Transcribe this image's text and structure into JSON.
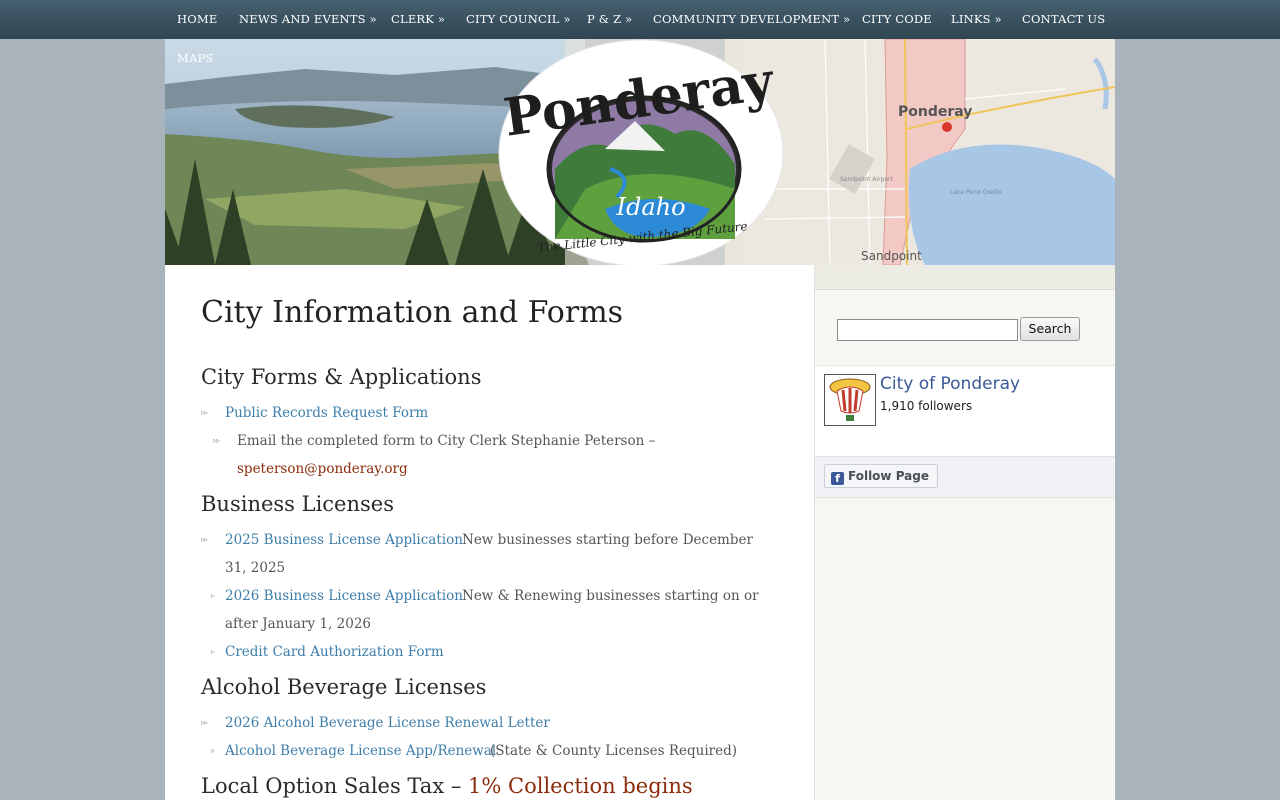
{
  "nav": {
    "items": [
      "HOME",
      "NEWS AND EVENTS »",
      "CLERK »",
      "CITY COUNCIL »",
      "P & Z »",
      "COMMUNITY DEVELOPMENT »",
      "CITY CODE",
      "LINKS »",
      "CONTACT US"
    ],
    "maps": "MAPS"
  },
  "logo": {
    "brand": "Ponderay",
    "state": "Idaho",
    "tagline": "The Little City with the Big Future"
  },
  "map": {
    "city_label": "Ponderay",
    "town_label": "Sandpoint",
    "lake_label": "Lake Pend Oreille",
    "airport_label": "Sandpoint Airport"
  },
  "page": {
    "title": "City Information and Forms"
  },
  "sections": {
    "forms": {
      "heading": "City Forms & Applications",
      "public_records_link": "Public Records Request Form",
      "email_note": "Email the completed form to City Clerk Stephanie Peterson –",
      "email": "speterson@ponderay.org"
    },
    "business": {
      "heading": "Business Licenses",
      "app_2025_link": "2025 Business License Application",
      "app_2025_desc_1": "New businesses starting before December",
      "app_2025_desc_2": "31, 2025",
      "app_2026_link": "2026 Business License Application",
      "app_2026_desc_1": "New & Renewing businesses starting on or",
      "app_2026_desc_2": "after January 1, 2026",
      "credit_card_link": "Credit Card Authorization Form"
    },
    "alcohol": {
      "heading": "Alcohol Beverage Licenses",
      "renewal_letter_link": "2026 Alcohol Beverage License Renewal Letter",
      "app_link": "Alcohol Beverage License App/Renewal",
      "app_note": "(State & County Licenses Required)"
    },
    "sales_tax": {
      "heading_prefix": "Local Option Sales Tax –",
      "heading_highlight": "1% Collection begins"
    }
  },
  "sidebar": {
    "search_value": "",
    "search_button": "Search",
    "facebook": {
      "page_name": "City of Ponderay",
      "followers": "1,910 followers",
      "follow_button": "Follow Page",
      "f_glyph": "f"
    }
  },
  "colors": {
    "nav_bg": "#3a5361",
    "link": "#3d7eaa",
    "rust": "#8a2b0a",
    "facebook": "#3b5998"
  }
}
